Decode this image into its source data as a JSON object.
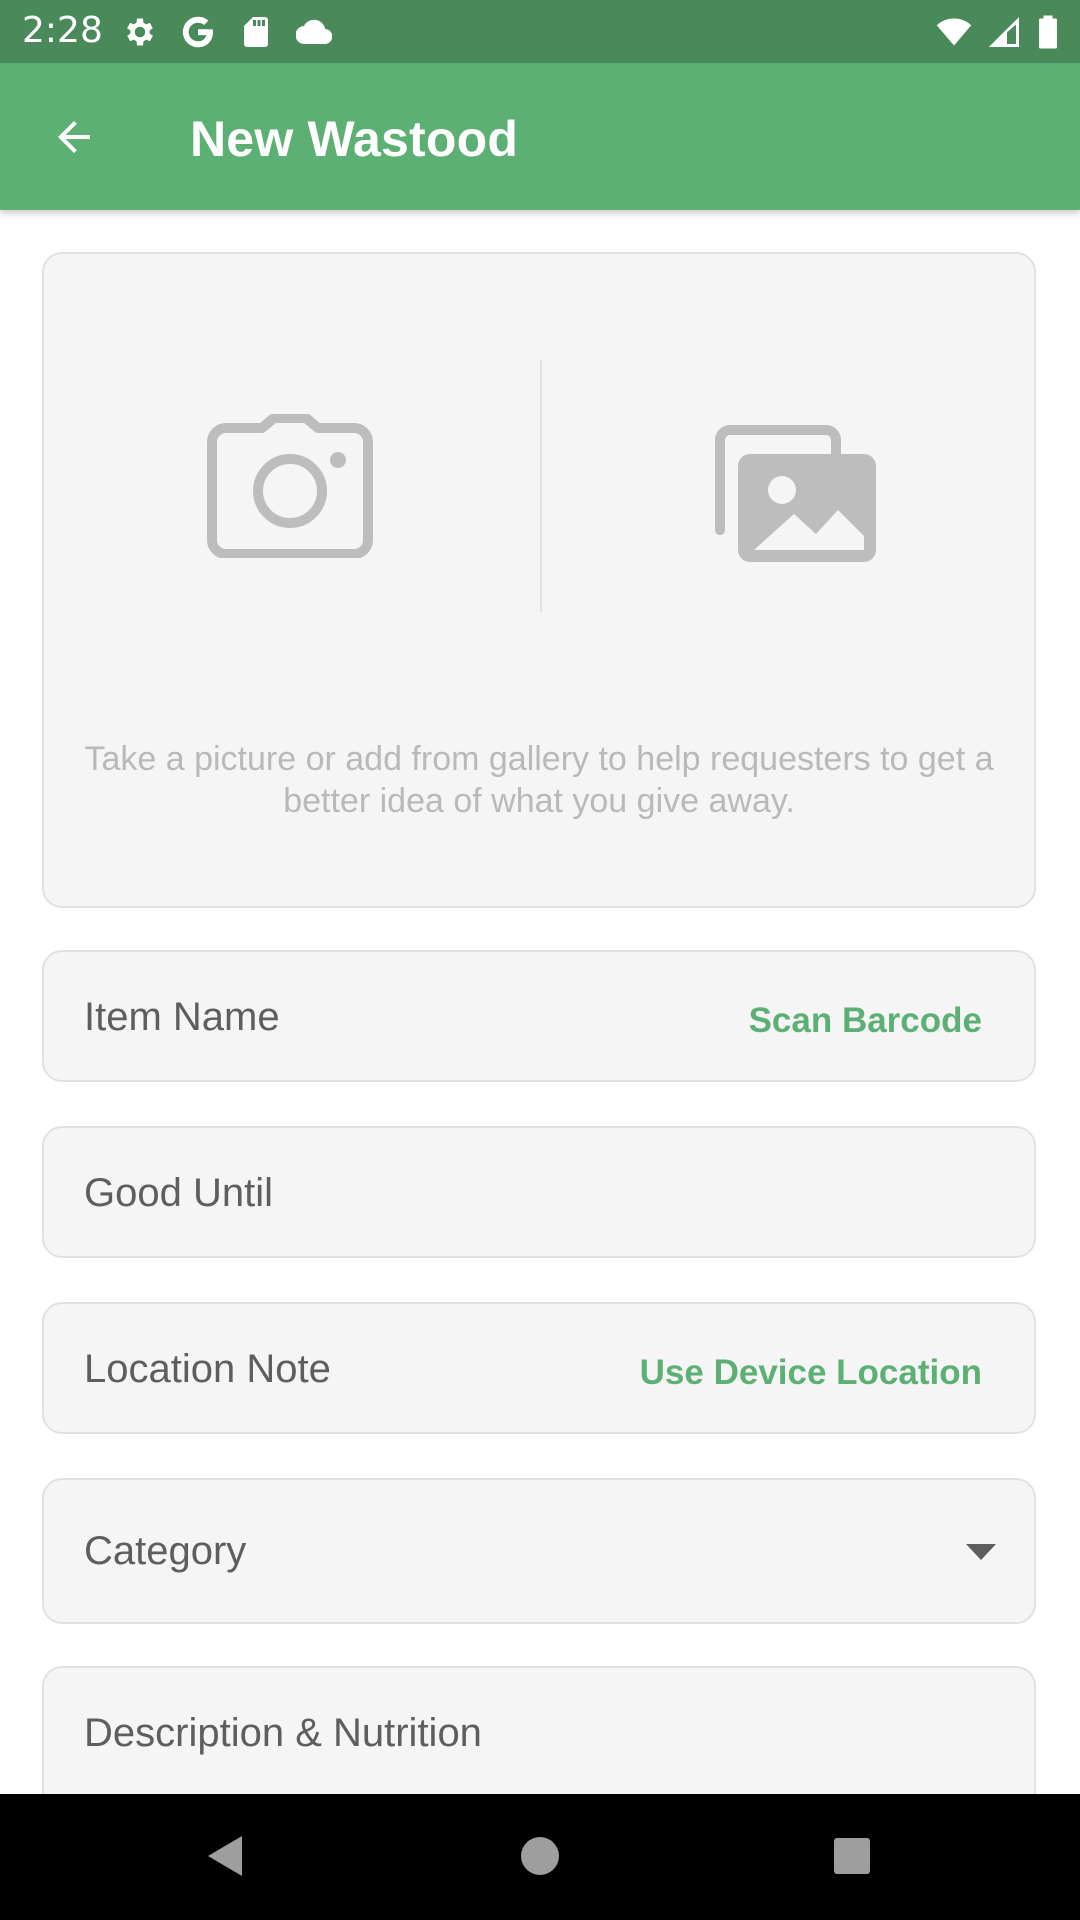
{
  "status_bar": {
    "time": "2:28",
    "left_icons": [
      "settings-icon",
      "google-icon",
      "sd-card-icon",
      "cloud-icon"
    ],
    "right_icons": [
      "wifi-icon",
      "cell-signal-icon",
      "battery-icon"
    ]
  },
  "app_bar": {
    "title": "New Wastood",
    "back_icon": "arrow-back-icon",
    "color": "#5db073"
  },
  "photo_card": {
    "camera_icon": "camera-icon",
    "gallery_icon": "gallery-icon",
    "hint": "Take a picture or add from gallery to help requesters to get a better idea of what you give away."
  },
  "fields": {
    "item_name": {
      "label": "Item Name",
      "action": "Scan Barcode"
    },
    "good_until": {
      "label": "Good Until"
    },
    "location_note": {
      "label": "Location Note",
      "action": "Use Device Location"
    },
    "category": {
      "label": "Category",
      "icon": "dropdown-arrow-icon"
    },
    "description": {
      "label": "Description & Nutrition"
    }
  },
  "nav_bar": {
    "back": "nav-back-icon",
    "home": "nav-home-icon",
    "recents": "nav-recents-icon"
  },
  "colors": {
    "accent": "#5db073",
    "status_bar": "#4a8a5a",
    "card_bg": "#f5f5f5",
    "icon_gray": "#bdbdbd"
  }
}
